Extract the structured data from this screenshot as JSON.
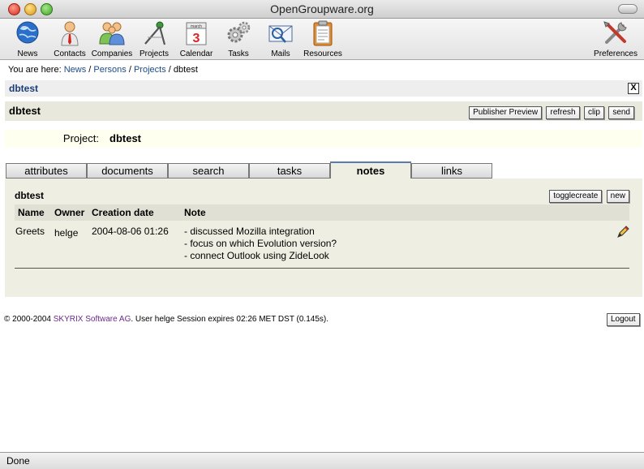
{
  "window": {
    "title": "OpenGroupware.org"
  },
  "toolbar": {
    "items": [
      {
        "label": "News",
        "icon": "globe-icon"
      },
      {
        "label": "Contacts",
        "icon": "person-icon"
      },
      {
        "label": "Companies",
        "icon": "people-icon"
      },
      {
        "label": "Projects",
        "icon": "compass-icon"
      },
      {
        "label": "Calendar",
        "icon": "calendar-icon",
        "day": "3",
        "month": "march"
      },
      {
        "label": "Tasks",
        "icon": "gears-icon"
      },
      {
        "label": "Mails",
        "icon": "mail-icon"
      },
      {
        "label": "Resources",
        "icon": "clipboard-icon"
      }
    ],
    "preferences": {
      "label": "Preferences",
      "icon": "tools-icon"
    }
  },
  "breadcrumb": {
    "prefix": "You are here:",
    "links": [
      "News",
      "Persons",
      "Projects"
    ],
    "current": "dbtest",
    "separator": "/"
  },
  "section": {
    "title": "dbtest",
    "close": "X"
  },
  "object": {
    "title": "dbtest",
    "buttons": [
      "Publisher Preview",
      "refresh",
      "clip",
      "send"
    ]
  },
  "project": {
    "label": "Project:",
    "value": "dbtest"
  },
  "tabs": [
    {
      "label": "attributes",
      "active": false
    },
    {
      "label": "documents",
      "active": false
    },
    {
      "label": "search",
      "active": false
    },
    {
      "label": "tasks",
      "active": false
    },
    {
      "label": "notes",
      "active": true
    },
    {
      "label": "links",
      "active": false
    }
  ],
  "notes": {
    "title": "dbtest",
    "buttons": [
      "togglecreate",
      "new"
    ],
    "columns": [
      "Name",
      "Owner",
      "Creation date",
      "Note"
    ],
    "rows": [
      {
        "name": "Greets",
        "owner": "helge",
        "created": "2004-08-06 01:26",
        "lines": [
          "- discussed Mozilla integration",
          "- focus on which Evolution version?",
          "- connect Outlook using ZideLook"
        ]
      }
    ]
  },
  "footer": {
    "copyright": "© 2000-2004",
    "org": "SKYRIX Software AG",
    "rest": ". User helge Session expires 02:26 MET DST (0.145s).",
    "logout": "Logout"
  },
  "status": {
    "text": "Done"
  },
  "colors": {
    "link": "#1a4a8a",
    "panel": "#eeeee2",
    "section_title": "#1a3d7a"
  }
}
